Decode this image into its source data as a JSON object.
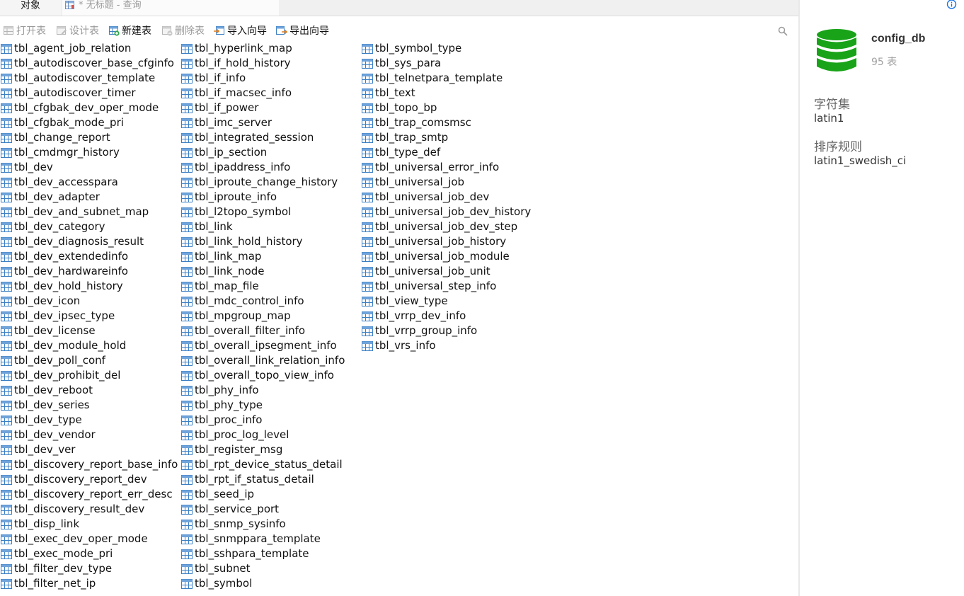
{
  "tabs": {
    "objects": "对象",
    "query": "* 无标题 - 查询"
  },
  "toolbar": {
    "open_table": "打开表",
    "design_table": "设计表",
    "new_table": "新建表",
    "delete_table": "删除表",
    "import_wizard": "导入向导",
    "export_wizard": "导出向导"
  },
  "tables": {
    "col1": [
      "tbl_agent_job_relation",
      "tbl_autodiscover_base_cfginfo",
      "tbl_autodiscover_template",
      "tbl_autodiscover_timer",
      "tbl_cfgbak_dev_oper_mode",
      "tbl_cfgbak_mode_pri",
      "tbl_change_report",
      "tbl_cmdmgr_history",
      "tbl_dev",
      "tbl_dev_accesspara",
      "tbl_dev_adapter",
      "tbl_dev_and_subnet_map",
      "tbl_dev_category",
      "tbl_dev_diagnosis_result",
      "tbl_dev_extendedinfo",
      "tbl_dev_hardwareinfo",
      "tbl_dev_hold_history",
      "tbl_dev_icon",
      "tbl_dev_ipsec_type",
      "tbl_dev_license",
      "tbl_dev_module_hold",
      "tbl_dev_poll_conf",
      "tbl_dev_prohibit_del",
      "tbl_dev_reboot",
      "tbl_dev_series",
      "tbl_dev_type",
      "tbl_dev_vendor",
      "tbl_dev_ver",
      "tbl_discovery_report_base_info",
      "tbl_discovery_report_dev",
      "tbl_discovery_report_err_desc",
      "tbl_discovery_result_dev",
      "tbl_disp_link",
      "tbl_exec_dev_oper_mode",
      "tbl_exec_mode_pri",
      "tbl_filter_dev_type",
      "tbl_filter_net_ip"
    ],
    "col2": [
      "tbl_hyperlink_map",
      "tbl_if_hold_history",
      "tbl_if_info",
      "tbl_if_macsec_info",
      "tbl_if_power",
      "tbl_imc_server",
      "tbl_integrated_session",
      "tbl_ip_section",
      "tbl_ipaddress_info",
      "tbl_iproute_change_history",
      "tbl_iproute_info",
      "tbl_l2topo_symbol",
      "tbl_link",
      "tbl_link_hold_history",
      "tbl_link_map",
      "tbl_link_node",
      "tbl_map_file",
      "tbl_mdc_control_info",
      "tbl_mpgroup_map",
      "tbl_overall_filter_info",
      "tbl_overall_ipsegment_info",
      "tbl_overall_link_relation_info",
      "tbl_overall_topo_view_info",
      "tbl_phy_info",
      "tbl_phy_type",
      "tbl_proc_info",
      "tbl_proc_log_level",
      "tbl_register_msg",
      "tbl_rpt_device_status_detail",
      "tbl_rpt_if_status_detail",
      "tbl_seed_ip",
      "tbl_service_port",
      "tbl_snmp_sysinfo",
      "tbl_snmppara_template",
      "tbl_sshpara_template",
      "tbl_subnet",
      "tbl_symbol"
    ],
    "col3": [
      "tbl_symbol_type",
      "tbl_sys_para",
      "tbl_telnetpara_template",
      "tbl_text",
      "tbl_topo_bp",
      "tbl_trap_comsmsc",
      "tbl_trap_smtp",
      "tbl_type_def",
      "tbl_universal_error_info",
      "tbl_universal_job",
      "tbl_universal_job_dev",
      "tbl_universal_job_dev_history",
      "tbl_universal_job_dev_step",
      "tbl_universal_job_history",
      "tbl_universal_job_module",
      "tbl_universal_job_unit",
      "tbl_universal_step_info",
      "tbl_view_type",
      "tbl_vrrp_dev_info",
      "tbl_vrrp_group_info",
      "tbl_vrs_info"
    ]
  },
  "panel": {
    "db_name": "config_db",
    "table_count": "95 表",
    "charset_label": "字符集",
    "charset_value": "latin1",
    "collation_label": "排序规则",
    "collation_value": "latin1_swedish_ci"
  },
  "colors": {
    "db_green": "#19a319",
    "table_icon_blue": "#3b7fc4",
    "info_blue": "#1a73e8"
  }
}
